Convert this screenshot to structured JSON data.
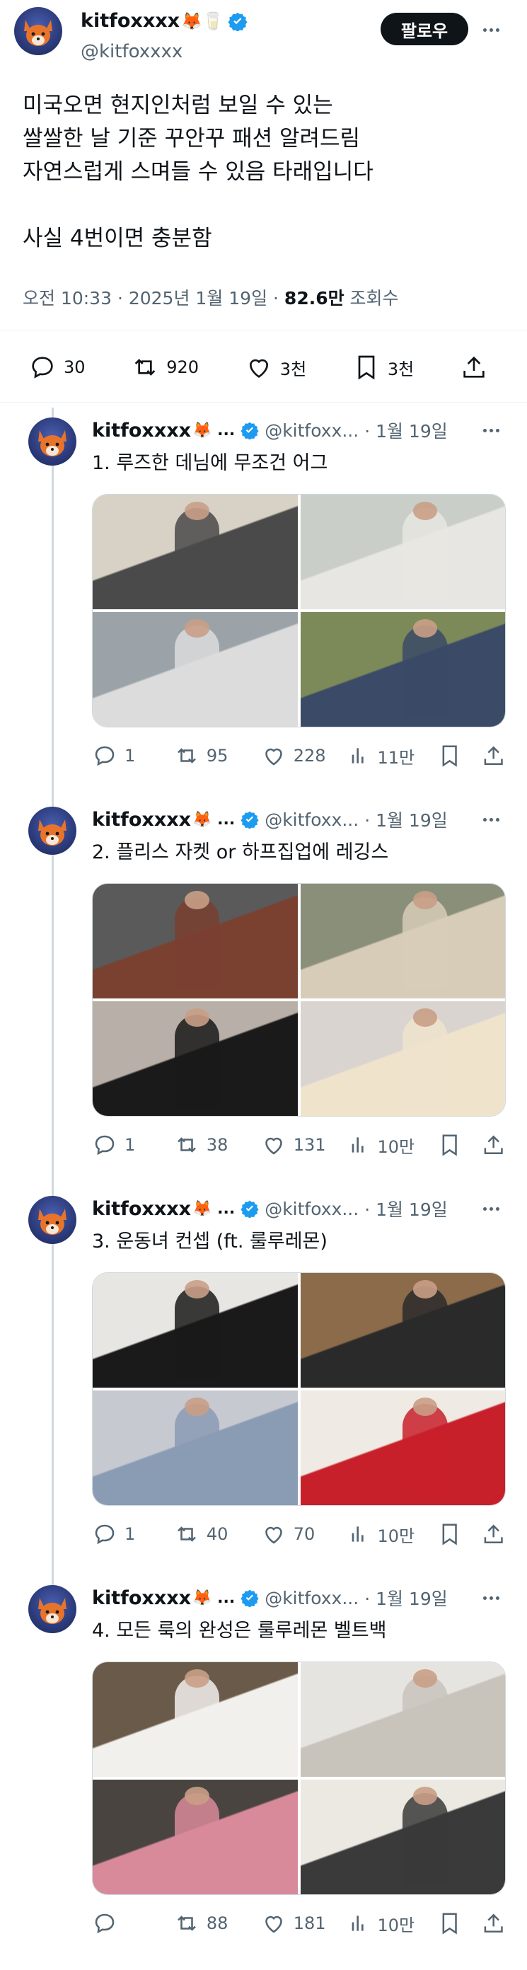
{
  "main": {
    "author": {
      "name": "kitfoxxxx",
      "emoji": "🦊🥛",
      "handle": "@kitfoxxxx"
    },
    "follow_label": "팔로우",
    "text": "미국오면 현지인처럼 보일 수 있는\n쌀쌀한 날 기준 꾸안꾸 패션 알려드림\n자연스럽게 스며들 수 있음 타래입니다\n\n사실 4번이면 충분함",
    "time": "오전 10:33 · 2025년 1월 19일 · ",
    "views_count": "82.6만",
    "views_label": " 조회수",
    "stats": {
      "replies": "30",
      "reposts": "920",
      "likes": "3천",
      "bookmarks": "3천"
    }
  },
  "replies": [
    {
      "name": "kitfoxxxx",
      "emoji": "🦊 ...",
      "handle": "@kitfoxx...",
      "date": "· 1월 19일",
      "text": "1. 루즈한 데님에 무조건 어그",
      "stats": {
        "replies": "1",
        "reposts": "95",
        "likes": "228",
        "views": "11만"
      },
      "photo_colors": [
        [
          "#d8d2c6",
          "#4a4a4a"
        ],
        [
          "#c9cfc8",
          "#e8e6e2"
        ],
        [
          "#9ca3a8",
          "#dcdcdc"
        ],
        [
          "#7c8a5a",
          "#3b4a66"
        ]
      ]
    },
    {
      "name": "kitfoxxxx",
      "emoji": "🦊 ...",
      "handle": "@kitfoxx...",
      "date": "· 1월 19일",
      "text": "2. 플리스 자켓 or 하프집업에 레깅스",
      "stats": {
        "replies": "1",
        "reposts": "38",
        "likes": "131",
        "views": "10만"
      },
      "photo_colors": [
        [
          "#5a5a5a",
          "#7a4030"
        ],
        [
          "#8a8f7a",
          "#d7ccb8"
        ],
        [
          "#b8b0a8",
          "#1a1a1a"
        ],
        [
          "#d9d4cf",
          "#efe3cc"
        ]
      ]
    },
    {
      "name": "kitfoxxxx",
      "emoji": "🦊 ...",
      "handle": "@kitfoxx...",
      "date": "· 1월 19일",
      "text": "3. 운동녀 컨셉 (ft. 룰루레몬)",
      "stats": {
        "replies": "1",
        "reposts": "40",
        "likes": "70",
        "views": "10만"
      },
      "photo_colors": [
        [
          "#e8e6e3",
          "#1a1a1a"
        ],
        [
          "#8b6b4a",
          "#2a2a2a"
        ],
        [
          "#c6cad0",
          "#8a9bb4"
        ],
        [
          "#efeae4",
          "#c8202a"
        ]
      ]
    },
    {
      "name": "kitfoxxxx",
      "emoji": "🦊 ...",
      "handle": "@kitfoxx...",
      "date": "· 1월 19일",
      "text": "4. 모든 룩의 완성은 룰루레몬 벨트백",
      "stats": {
        "replies": "",
        "reposts": "88",
        "likes": "181",
        "views": "10만"
      },
      "photo_colors": [
        [
          "#6a5a4a",
          "#f2f0ec"
        ],
        [
          "#e6e4e0",
          "#c8c4bc"
        ],
        [
          "#4a4440",
          "#d88a9a"
        ],
        [
          "#ece8e2",
          "#3a3a3a"
        ]
      ]
    }
  ],
  "colors": {
    "verified": "#1d9bf0",
    "text": "#0f1419",
    "muted": "#536471"
  }
}
